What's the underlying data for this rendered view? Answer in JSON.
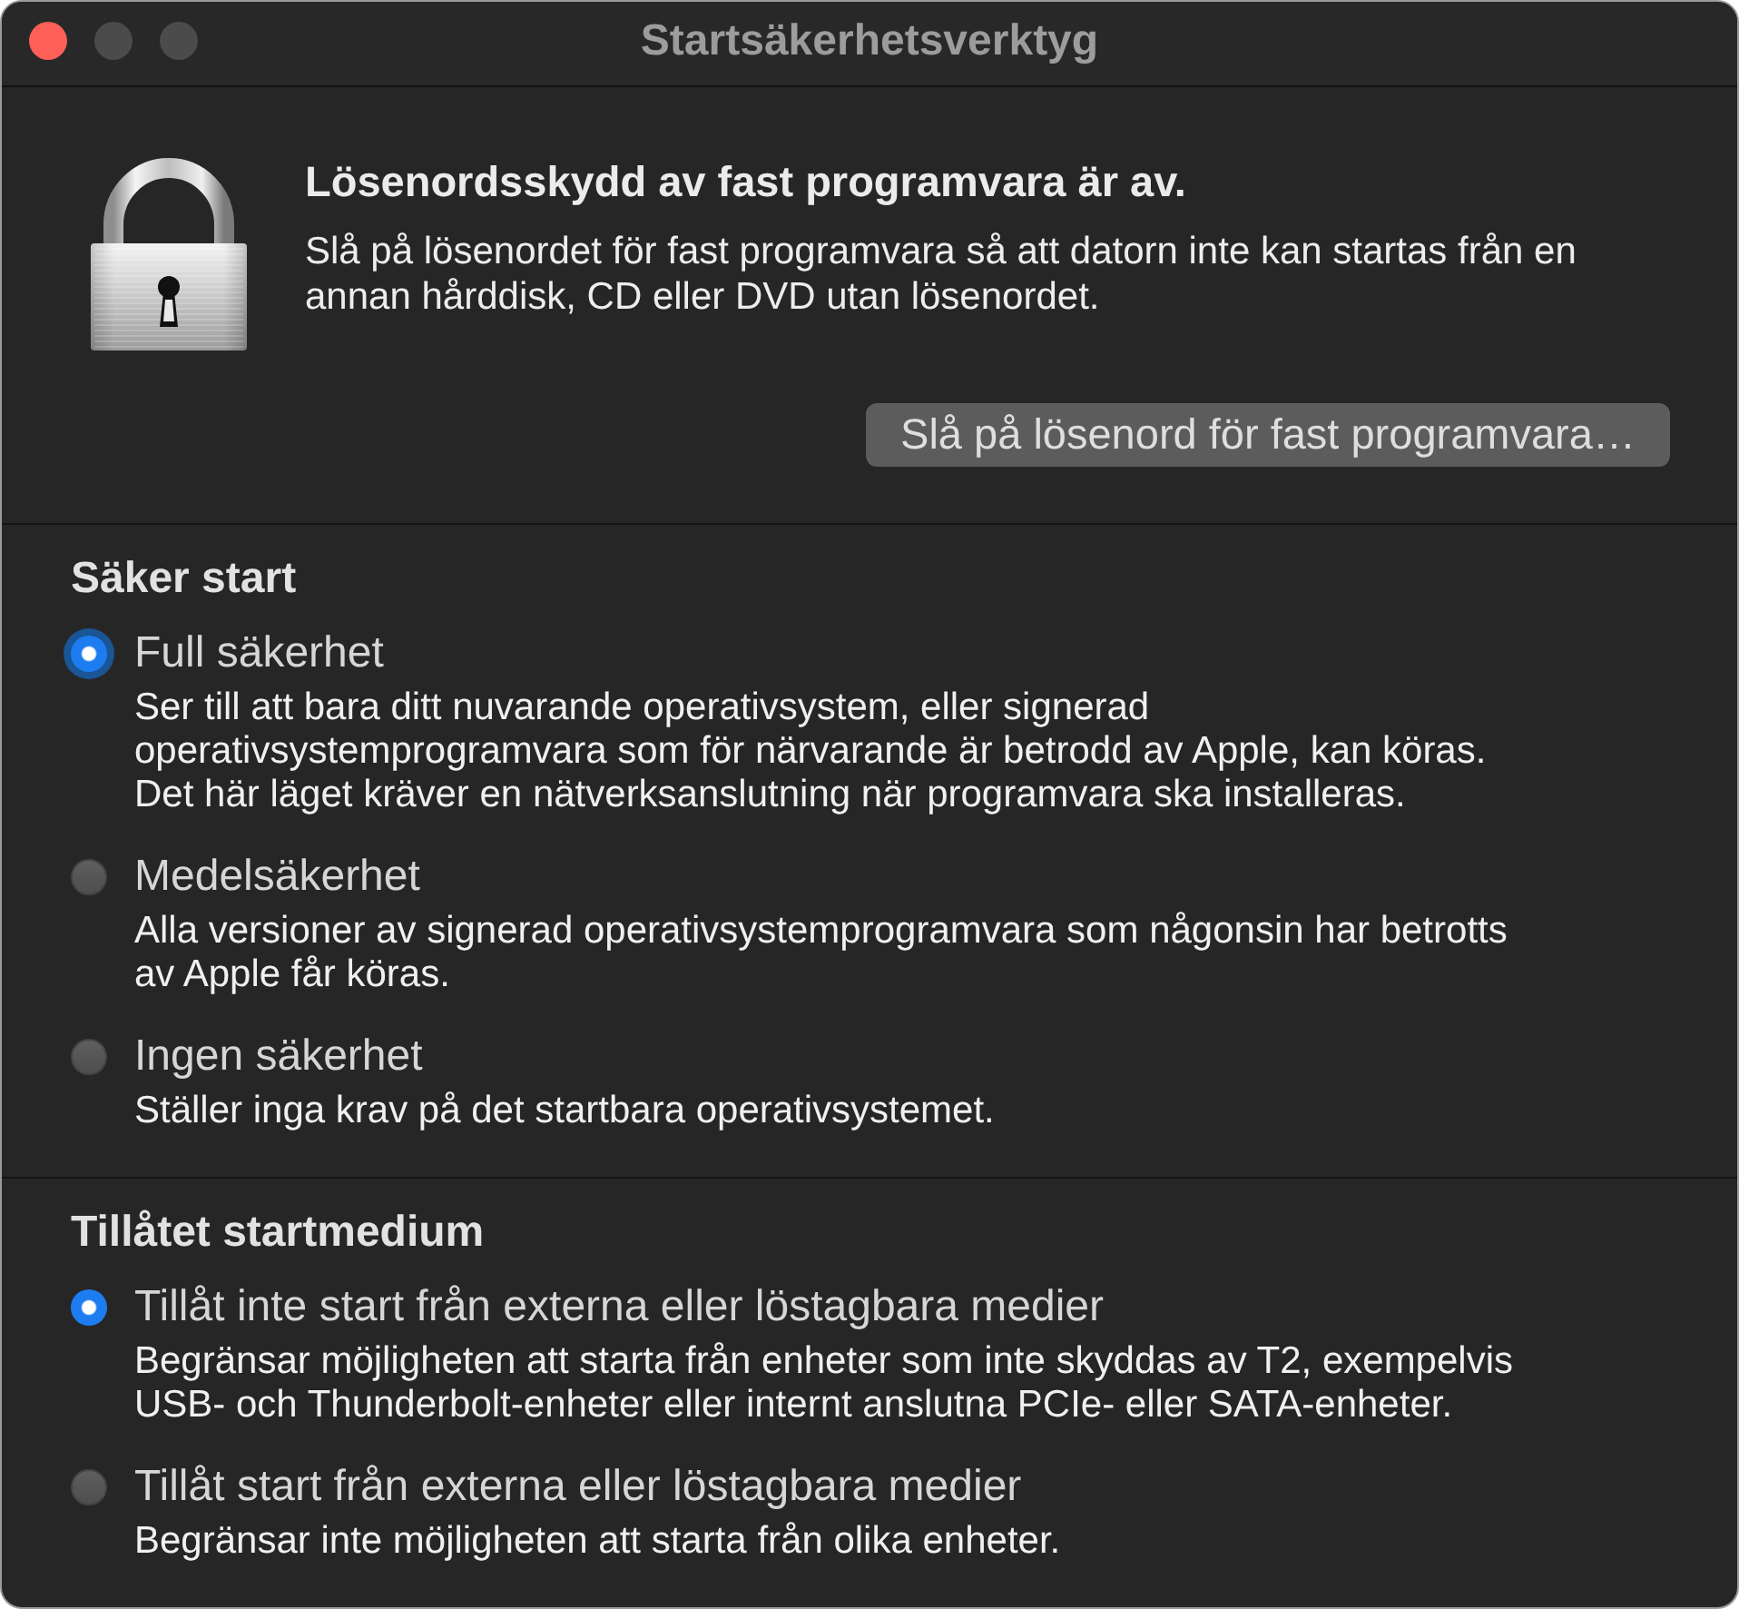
{
  "window": {
    "title": "Startsäkerhetsverktyg"
  },
  "firmware_password": {
    "heading": "Lösenordsskydd av fast programvara är av.",
    "description": "Slå på lösenordet för fast programvara så att datorn inte kan startas från en annan hårddisk, CD eller DVD utan lösenordet.",
    "button": "Slå på lösenord för fast programvara…"
  },
  "sections": [
    {
      "title": "Säker start",
      "options": [
        {
          "label": "Full säkerhet",
          "description": "Ser till att bara ditt nuvarande operativsystem, eller signerad operativsystemprogramvara som för närvarande är betrodd av Apple, kan köras. Det här läget kräver en nätverksanslutning när programvara ska installeras.",
          "selected": true,
          "focused": true
        },
        {
          "label": "Medelsäkerhet",
          "description": "Alla versioner av signerad operativsystemprogramvara som någonsin har betrotts av Apple får köras.",
          "selected": false,
          "focused": false
        },
        {
          "label": "Ingen säkerhet",
          "description": "Ställer inga krav på det startbara operativsystemet.",
          "selected": false,
          "focused": false
        }
      ]
    },
    {
      "title": "Tillåtet startmedium",
      "options": [
        {
          "label": "Tillåt inte start från externa eller löstagbara medier",
          "description": "Begränsar möjligheten att starta från enheter som inte skyddas av T2, exempelvis USB- och Thunderbolt-enheter eller internt anslutna PCIe- eller SATA-enheter.",
          "selected": true,
          "focused": false
        },
        {
          "label": "Tillåt start från externa eller löstagbara medier",
          "description": "Begränsar inte möjligheten att starta från olika enheter.",
          "selected": false,
          "focused": false
        }
      ]
    }
  ]
}
